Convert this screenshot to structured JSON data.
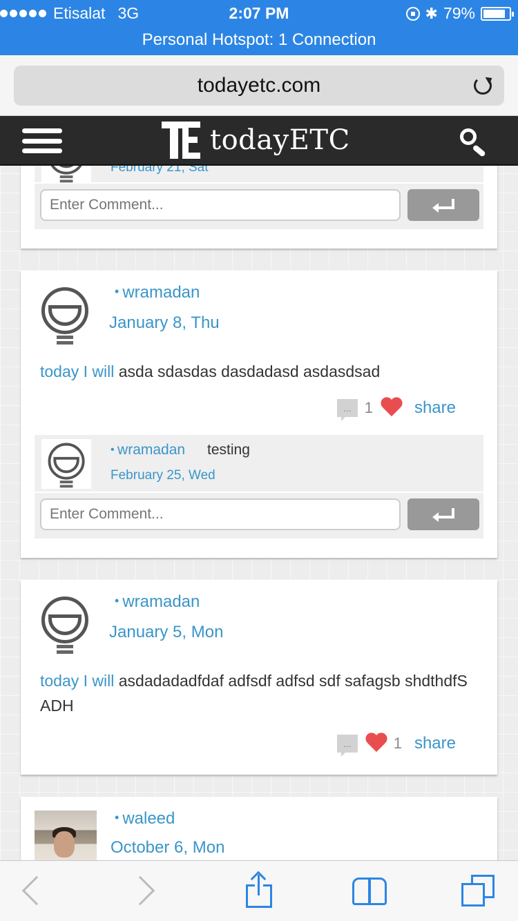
{
  "status_bar": {
    "carrier": "Etisalat",
    "network": "3G",
    "time": "2:07 PM",
    "battery": "79%",
    "icons": [
      "signal-dots",
      "lock-rotation-icon",
      "bluetooth-icon",
      "battery-icon"
    ]
  },
  "hotspot_banner": "Personal Hotspot: 1 Connection",
  "browser": {
    "url": "todayetc.com"
  },
  "site": {
    "logo_text": "todayETC"
  },
  "posts": [
    {
      "partial_date": "February 21, Sat",
      "comment_placeholder": "Enter Comment..."
    },
    {
      "username": "wramadan",
      "date": "January 8, Thu",
      "prefix": "today I will",
      "text": "asda sdasdas dasdadasd asdasdsad",
      "comment_count": "1",
      "share_label": "share",
      "comments": [
        {
          "username": "wramadan",
          "text": "testing",
          "date": "February 25, Wed"
        }
      ],
      "comment_placeholder": "Enter Comment..."
    },
    {
      "username": "wramadan",
      "date": "January 5, Mon",
      "prefix": "today I will",
      "text": "asdadadadfdaf adfsdf adfsd sdf safagsb shdthdfS ADH",
      "like_count": "1",
      "share_label": "share"
    },
    {
      "username": "waleed",
      "date": "October 6, Mon"
    }
  ],
  "colors": {
    "status_bar": "#2c85e4",
    "link": "#3a95c9",
    "header": "#2a2a2a",
    "heart": "#e84e50"
  }
}
